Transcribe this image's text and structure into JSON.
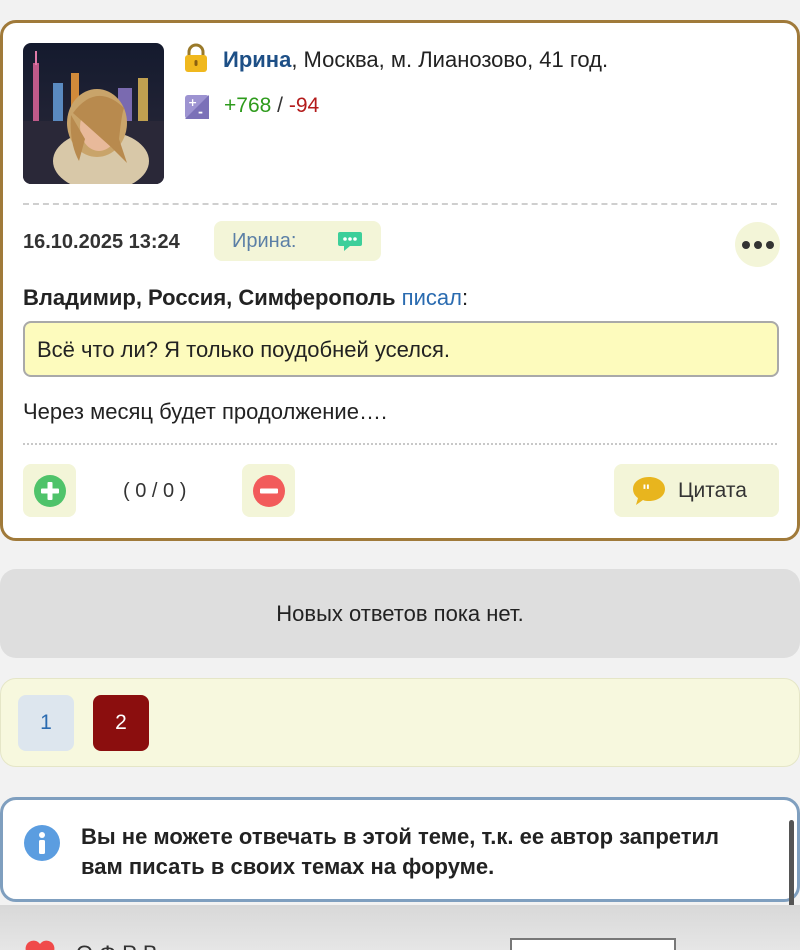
{
  "post": {
    "author": {
      "name": "Ирина",
      "details": " Москва, м. Лианозово, 41 год."
    },
    "rating": {
      "plus": "+768",
      "separator": " / ",
      "minus": "-94"
    },
    "date": "16.10.2025 13:24",
    "reply_to_label": "Ирина:",
    "quote": {
      "author": "Владимир, Россия, Симферополь",
      "wrote": "писал",
      "colon": ":",
      "text": "Всё что ли? Я только поудобней уселся."
    },
    "text": "Через месяц будет продолжение….",
    "votes": "( 0 / 0 )",
    "quote_button_label": "Цитата"
  },
  "no_replies": "Новых ответов пока нет.",
  "pagination": {
    "pages": [
      "1",
      "2"
    ],
    "current": "2"
  },
  "notice": {
    "text": "Вы не можете отвечать в этой теме, т.к. ее автор запретил вам писать в своих темах на форуме."
  },
  "footer": {
    "text": "О Ф Р В"
  },
  "colors": {
    "card_border": "#a07a3a",
    "author_link": "#1d4f86",
    "rating_plus": "#2e9b1c",
    "rating_minus": "#b31b1b",
    "current_page": "#8b0e0e",
    "quote_background": "#fdfbbd",
    "notice_border": "#7f9fbf"
  },
  "icons": [
    "lock-icon",
    "rating-icon",
    "message-icon",
    "more-icon",
    "plus-icon",
    "minus-icon",
    "quote-icon",
    "info-icon",
    "heart-icon"
  ]
}
